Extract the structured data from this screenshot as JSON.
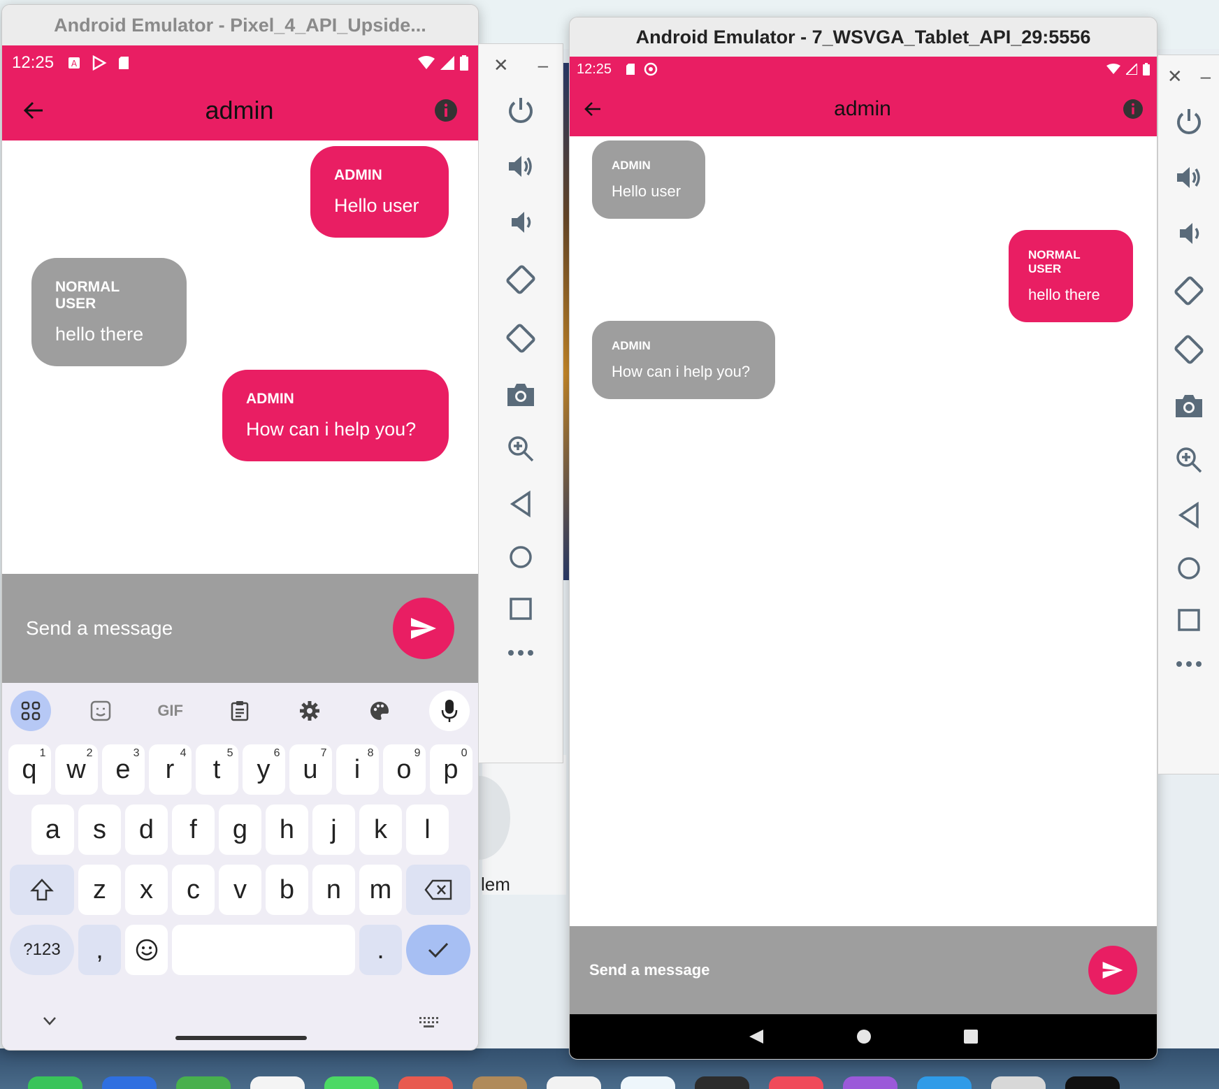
{
  "phone": {
    "window_title": "Android Emulator - Pixel_4_API_Upside...",
    "status_time": "12:25",
    "app_title": "admin",
    "messages": [
      {
        "sender": "ADMIN",
        "text": "Hello user"
      },
      {
        "sender": "NORMAL USER",
        "text": "hello there"
      },
      {
        "sender": "ADMIN",
        "text": "How can i help you?"
      }
    ],
    "input_placeholder": "Send a message",
    "keyboard": {
      "toolbar": {
        "gif": "GIF"
      },
      "row1": [
        {
          "k": "q",
          "n": "1"
        },
        {
          "k": "w",
          "n": "2"
        },
        {
          "k": "e",
          "n": "3"
        },
        {
          "k": "r",
          "n": "4"
        },
        {
          "k": "t",
          "n": "5"
        },
        {
          "k": "y",
          "n": "6"
        },
        {
          "k": "u",
          "n": "7"
        },
        {
          "k": "i",
          "n": "8"
        },
        {
          "k": "o",
          "n": "9"
        },
        {
          "k": "p",
          "n": "0"
        }
      ],
      "row2": [
        "a",
        "s",
        "d",
        "f",
        "g",
        "h",
        "j",
        "k",
        "l"
      ],
      "row3": [
        "z",
        "x",
        "c",
        "v",
        "b",
        "n",
        "m"
      ],
      "symbols": "?123",
      "comma": ",",
      "period": "."
    }
  },
  "tablet": {
    "window_title": "Android Emulator - 7_WSVGA_Tablet_API_29:5556",
    "status_time": "12:25",
    "app_title": "admin",
    "messages": [
      {
        "sender": "ADMIN",
        "text": "Hello user"
      },
      {
        "sender": "NORMAL USER",
        "text": "hello there"
      },
      {
        "sender": "ADMIN",
        "text": "How can i help you?"
      }
    ],
    "input_placeholder": "Send a message"
  },
  "toolbar_tools": [
    "power-icon",
    "volume-up-icon",
    "volume-down-icon",
    "rotate-left-icon",
    "rotate-right-icon",
    "camera-icon",
    "zoom-icon",
    "back-icon",
    "home-icon",
    "overview-icon",
    "more-icon"
  ],
  "background": {
    "partial_text": "lem"
  },
  "colors": {
    "accent": "#e91e63",
    "bubble_gray": "#9e9e9e",
    "composer": "#9e9e9e"
  }
}
